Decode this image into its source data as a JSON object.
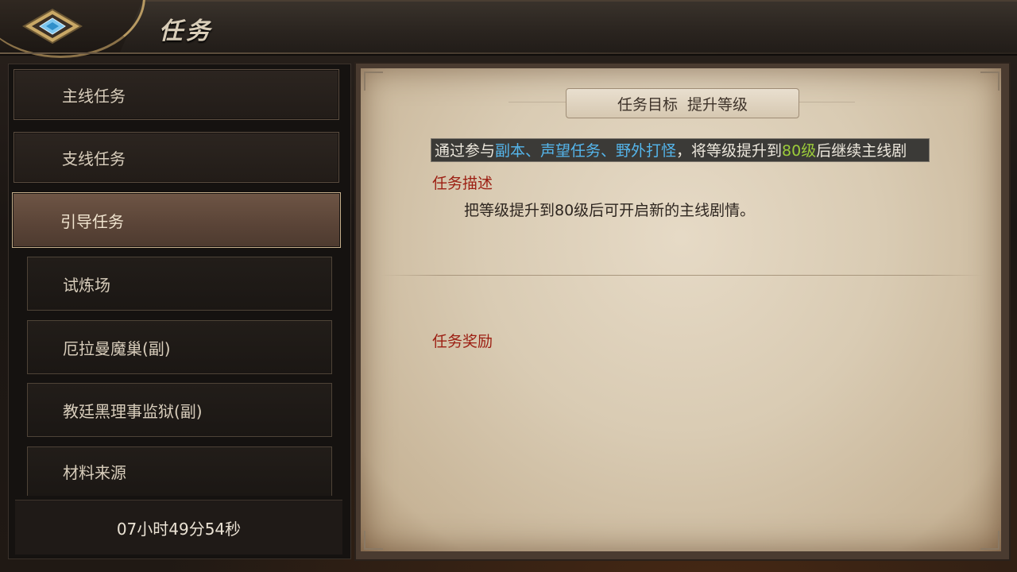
{
  "header": {
    "title": "任务",
    "back_icon": "diamond-back-icon"
  },
  "sidebar": {
    "tabs": [
      {
        "label": "主线任务",
        "active": false
      },
      {
        "label": "支线任务",
        "active": false
      },
      {
        "label": "引导任务",
        "active": true
      }
    ],
    "subitems": [
      {
        "label": "试炼场"
      },
      {
        "label": "厄拉曼魔巢(副)"
      },
      {
        "label": "教廷黑理事监狱(副)"
      },
      {
        "label": "材料来源"
      }
    ],
    "timer": "07小时49分54秒"
  },
  "quest": {
    "goal_title": "任务目标",
    "goal_value": "提升等级",
    "goal_text": {
      "part1": "通过参与",
      "highlight1": "副本、声望任务、野外打怪",
      "part2": "，将等级提升到",
      "highlight2": "80级",
      "part3": "后继续主线剧"
    },
    "description_label": "任务描述",
    "description": "把等级提升到80级后可开启新的主线剧情。",
    "reward_label": "任务奖励"
  },
  "colors": {
    "highlight_blue": "#55b6ec",
    "highlight_green": "#9ccc3a",
    "label_red": "#9c1e12",
    "active_tab": "#5a4437"
  }
}
